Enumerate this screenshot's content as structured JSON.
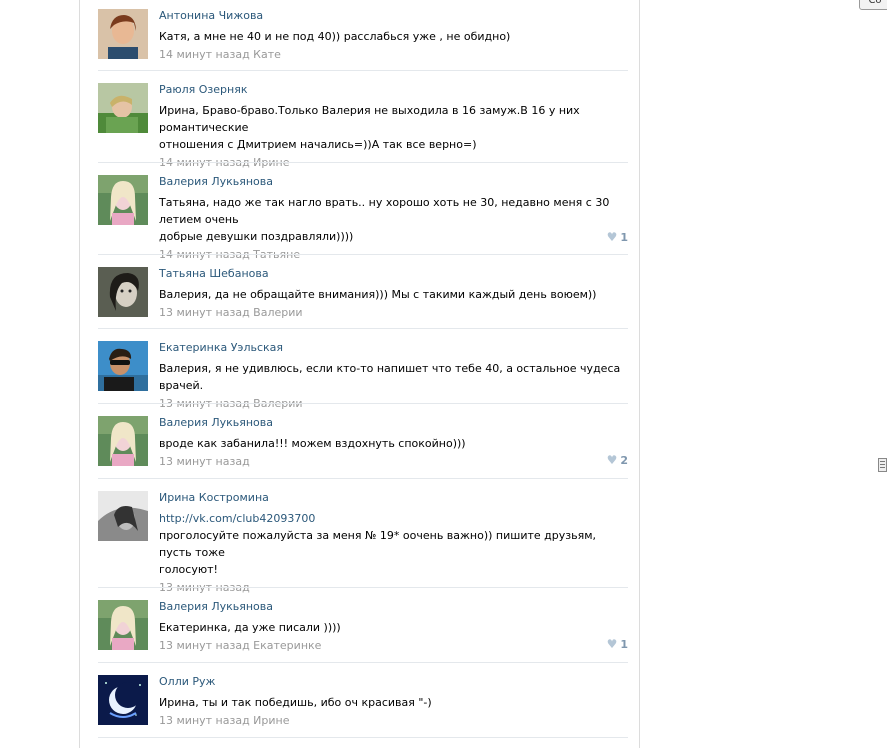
{
  "corner_button": "Со",
  "comments": [
    {
      "author": "Антонина Чижова",
      "text_lines": [
        "Катя, а мне не 40 и не под 40)) расслабься уже , не обидно)"
      ],
      "meta": "14 минут назад Кате",
      "likes": "",
      "avatar_icon": "user-photo-icon"
    },
    {
      "author": "Раюля Озерняк",
      "text_lines": [
        "Ирина, Браво-браво.Только Валерия не выходила в 16 замуж.В 16 у них романтические",
        "отношения с Дмитрием начались=))А так все верно=)"
      ],
      "meta": "14 минут назад Ирине",
      "likes": "",
      "avatar_icon": "user-photo-icon"
    },
    {
      "author": "Валерия Лукьянова",
      "text_lines": [
        "Татьяна, надо же так нагло врать.. ну хорошо хоть не 30, недавно меня с 30 летием очень",
        "добрые девушки поздравляли))))"
      ],
      "meta": "14 минут назад Татьяне",
      "likes": "1",
      "avatar_icon": "user-photo-icon"
    },
    {
      "author": "Татьяна Шебанова",
      "text_lines": [
        "Валерия, да не обращайте внимания))) Мы с такими каждый день воюем))"
      ],
      "meta": "13 минут назад Валерии",
      "likes": "",
      "avatar_icon": "user-photo-icon"
    },
    {
      "author": "Екатеринка Уэльская",
      "text_lines": [
        "Валерия, я не удивлюсь, если кто-то напишет что тебе 40, а остальное чудеса врачей."
      ],
      "meta": "13 минут назад Валерии",
      "likes": "",
      "avatar_icon": "user-photo-icon"
    },
    {
      "author": "Валерия Лукьянова",
      "text_lines": [
        "вроде как забанила!!! можем вздохнуть спокойно)))"
      ],
      "meta": "13 минут назад",
      "likes": "2",
      "avatar_icon": "user-photo-icon"
    },
    {
      "author": "Ирина Костромина",
      "link": "http://vk.com/club42093700",
      "text_lines": [
        "проголосуйте пожалуйста за меня № 19* оочень важно)) пишите друзьям, пусть тоже",
        "голосуют!"
      ],
      "meta": "13 минут назад",
      "likes": "",
      "avatar_icon": "user-photo-icon"
    },
    {
      "author": "Валерия Лукьянова",
      "text_lines": [
        "Екатеринка, да уже писали ))))"
      ],
      "meta": "13 минут назад Екатеринке",
      "likes": "1",
      "avatar_icon": "user-photo-icon"
    },
    {
      "author": "Олли Руж",
      "text_lines": [
        "Ирина, ты и так победишь, ибо оч красивая \"-)"
      ],
      "meta": "13 минут назад Ирине",
      "likes": "",
      "avatar_icon": "moon-photo-icon"
    }
  ],
  "colors": {
    "author_link": "#2b587a",
    "meta": "#999999",
    "separator": "#e4e8ec",
    "like": "#7f97ae"
  }
}
